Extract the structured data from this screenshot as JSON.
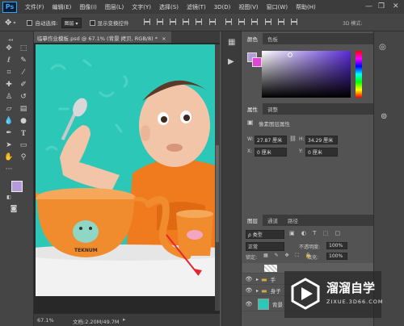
{
  "menubar": {
    "logo": "Ps",
    "items": [
      "文件(F)",
      "编辑(E)",
      "图像(I)",
      "图层(L)",
      "文字(Y)",
      "选择(S)",
      "滤镜(T)",
      "3D(D)",
      "视图(V)",
      "窗口(W)",
      "帮助(H)"
    ],
    "minimize": "—",
    "restore": "❐",
    "close": "✕"
  },
  "optionsbar": {
    "auto_select_label": "自动选择:",
    "auto_select_value": "图层",
    "show_transform_label": "显示变换控件",
    "threed_mode": "3D 模式:"
  },
  "document": {
    "tab_title": "临摹作业模板.psd @ 67.1% (背景 拷贝, RGB/8) *",
    "tab_close": "×",
    "zoom": "67.1%",
    "doc_info": "文档:2.20M/49.7M",
    "bowl_brand": "TEKNUM"
  },
  "color_panel": {
    "tabs": [
      "颜色",
      "色板"
    ],
    "fg_color": "#b59bdc",
    "bg_color": "#e044d8"
  },
  "properties_panel": {
    "tabs": [
      "属性",
      "调整"
    ],
    "header": "像素图层属性",
    "w_label": "W:",
    "w_value": "27.87 厘米",
    "h_label": "H:",
    "h_value": "34.29 厘米",
    "x_label": "X:",
    "x_value": "0 厘米",
    "y_label": "Y:",
    "y_value": "0 厘米"
  },
  "layers_panel": {
    "tabs": [
      "图层",
      "通道",
      "路径"
    ],
    "filter_label": "ρ 类型",
    "blend_mode": "正常",
    "opacity_label": "不透明度:",
    "opacity_value": "100%",
    "lock_label": "锁定:",
    "fill_label": "填充:",
    "fill_value": "100%",
    "layers": [
      {
        "name": "手"
      },
      {
        "name": "身子"
      },
      {
        "name": "背景"
      }
    ]
  },
  "watermark": {
    "title": "溜溜自学",
    "url": "ZIXUE.3D66.COM"
  },
  "colors": {
    "photo_bg": "#2dc7b8",
    "bowl": "#f08c2d",
    "bib": "#f07a1e"
  }
}
